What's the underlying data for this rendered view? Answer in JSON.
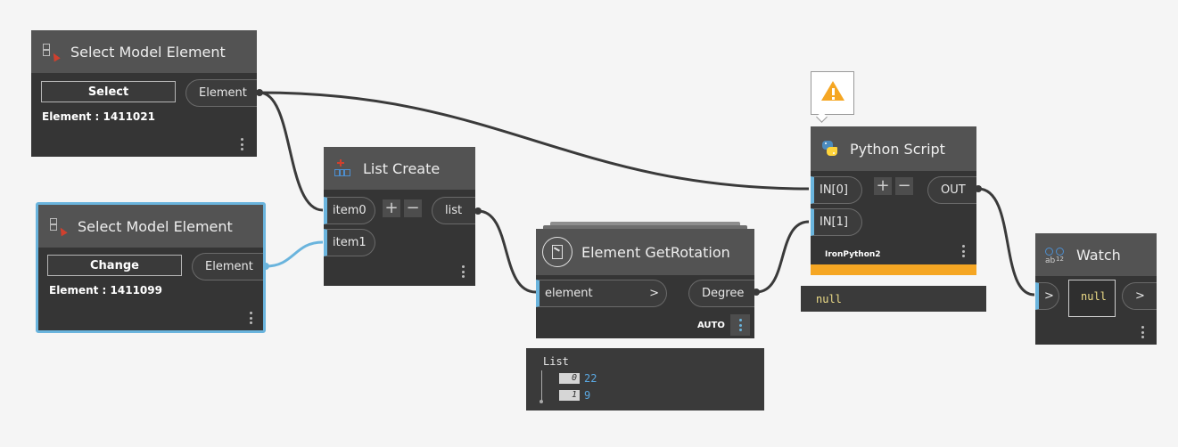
{
  "nodes": {
    "sme1": {
      "title": "Select Model Element",
      "button_label": "Select",
      "output_label": "Element",
      "info": "Element : 1411021",
      "icon": "select-model-element-icon"
    },
    "sme2": {
      "title": "Select Model Element",
      "button_label": "Change",
      "output_label": "Element",
      "info": "Element : 1411099",
      "icon": "select-model-element-icon"
    },
    "list_create": {
      "title": "List Create",
      "inputs": [
        "item0",
        "item1"
      ],
      "output_label": "list",
      "add_symbol": "+",
      "remove_symbol": "−",
      "icon": "list-create-icon"
    },
    "get_rotation": {
      "title": "Element GetRotation",
      "input_label": "element",
      "input_arrow": ">",
      "output_label": "Degree",
      "lacing": "AUTO",
      "icon": "element-get-rotation-icon"
    },
    "python": {
      "title": "Python Script",
      "inputs": [
        "IN[0]",
        "IN[1]"
      ],
      "output_label": "OUT",
      "add_symbol": "+",
      "remove_symbol": "−",
      "engine": "IronPython2",
      "preview_value": "null",
      "icon": "python-icon",
      "warning_icon": "warning-icon"
    },
    "watch": {
      "title": "Watch",
      "input_label": ">",
      "output_label": ">",
      "value": "null",
      "icon": "watch-icon"
    }
  },
  "rotation_preview": {
    "header": "List",
    "items": [
      {
        "index": "0",
        "value": "22"
      },
      {
        "index": "1",
        "value": "9"
      }
    ]
  },
  "colors": {
    "canvas": "#f5f5f5",
    "node_body": "#353535",
    "node_header": "#535353",
    "port_accent": "#6ab4dd",
    "selected_border": "#6ab4dd",
    "warning_bar": "#f5a623",
    "wire": "#3a3a3a",
    "null_text": "#eedd88",
    "list_value": "#5aa7e0"
  }
}
